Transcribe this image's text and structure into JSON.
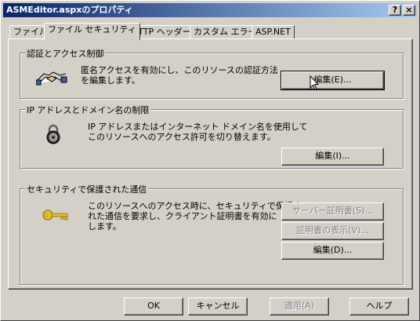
{
  "window": {
    "title": "ASMEditor.aspxのプロパティ",
    "help_button": "?",
    "close_button": "×"
  },
  "tabs": [
    {
      "label": "ファイル",
      "active": false
    },
    {
      "label": "ファイル セキュリティ",
      "active": true
    },
    {
      "label": "HTTP ヘッダー",
      "active": false
    },
    {
      "label": "カスタム エラー",
      "active": false
    },
    {
      "label": "ASP.NET",
      "active": false
    }
  ],
  "auth_group": {
    "title": "認証とアクセス制御",
    "text_line1": "匿名アクセスを有効にし、このリソースの認証方法",
    "text_line2": "を編集します。",
    "edit_button": "編集(E)...",
    "icon": "handshake-icon"
  },
  "ip_group": {
    "title": "IP アドレスとドメイン名の制限",
    "text_line1": "IP アドレスまたはインターネット ドメイン名を使用して",
    "text_line2": "このリソースへのアクセス許可を切り替えます。",
    "edit_button": "編集(I)...",
    "icon": "padlock-icon"
  },
  "secure_group": {
    "title": "セキュリティで保護された通信",
    "text_line1": "このリソースへのアクセス時に、セキュリティで保護さ",
    "text_line2": "れた通信を要求し、クライアント証明書を有効に",
    "text_line3": "します。",
    "server_cert_button": "サーバー証明書(S)...",
    "view_cert_button": "証明書の表示(V)...",
    "edit_button": "編集(D)...",
    "icon": "key-icon"
  },
  "footer": {
    "ok": "OK",
    "cancel": "キャンセル",
    "apply": "適用(A)",
    "help": "ヘルプ"
  }
}
